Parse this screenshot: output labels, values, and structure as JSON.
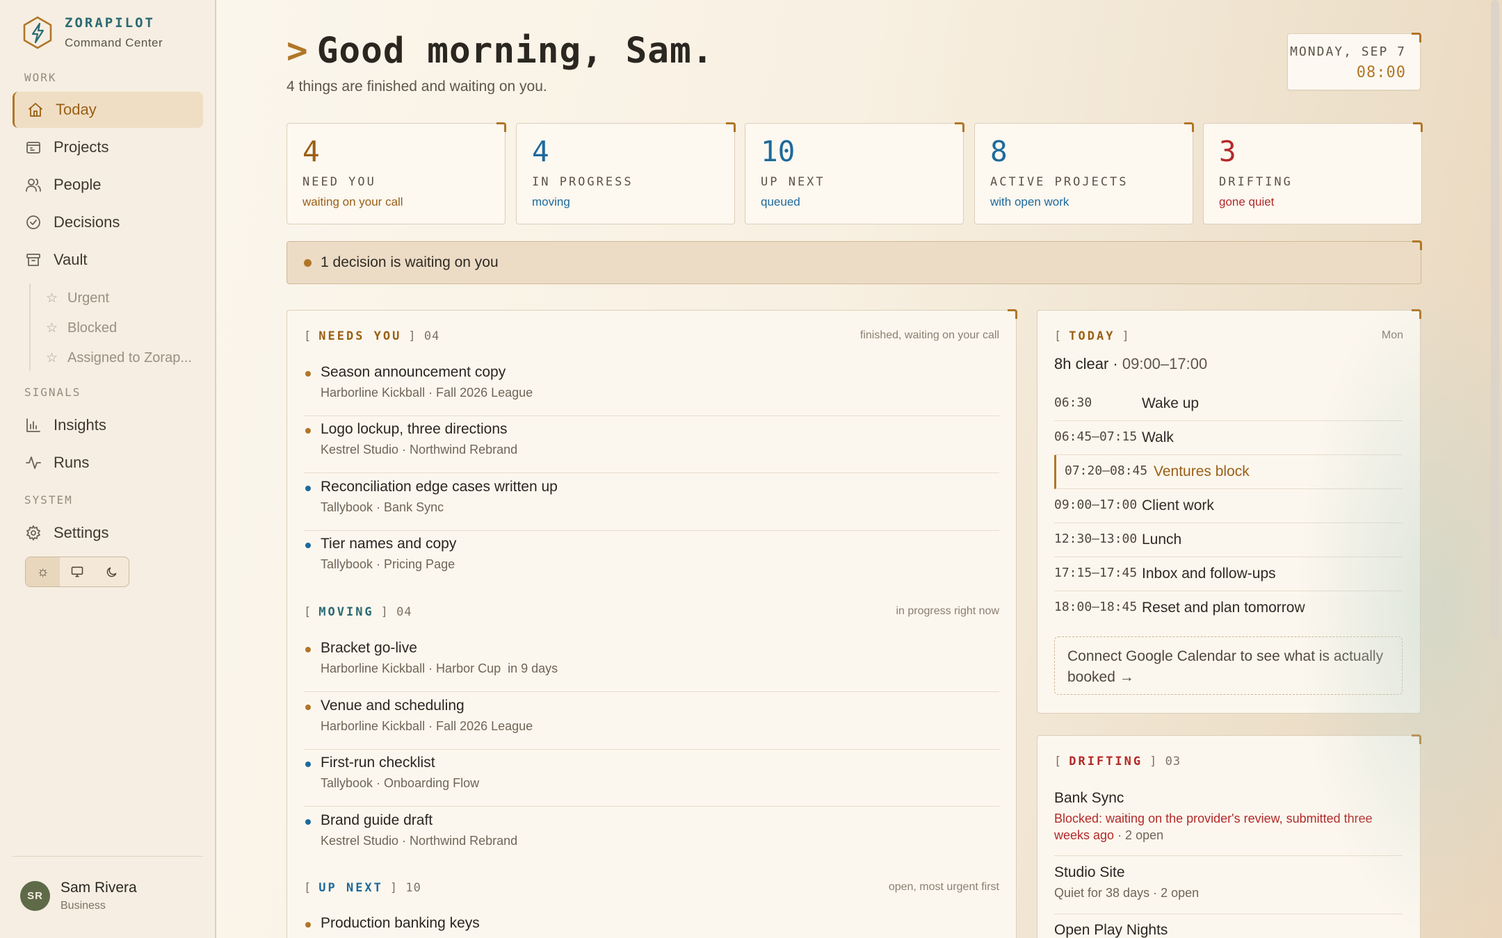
{
  "brand": {
    "name": "ZORAPILOT",
    "subtitle": "Command Center",
    "icon": "bolt-hexagon-icon"
  },
  "sidebar": {
    "sections": {
      "work": "WORK",
      "signals": "SIGNALS",
      "system": "SYSTEM"
    },
    "work_items": [
      {
        "label": "Today",
        "icon": "home-icon",
        "active": true
      },
      {
        "label": "Projects",
        "icon": "folder-icon"
      },
      {
        "label": "People",
        "icon": "people-icon"
      },
      {
        "label": "Decisions",
        "icon": "check-circle-icon"
      },
      {
        "label": "Vault",
        "icon": "archive-icon"
      }
    ],
    "vault_sub": [
      {
        "label": "Urgent",
        "icon": "star-icon"
      },
      {
        "label": "Blocked",
        "icon": "star-icon"
      },
      {
        "label": "Assigned to Zorap...",
        "icon": "star-icon"
      }
    ],
    "signal_items": [
      {
        "label": "Insights",
        "icon": "bar-chart-icon"
      },
      {
        "label": "Runs",
        "icon": "activity-icon"
      }
    ],
    "system_items": [
      {
        "label": "Settings",
        "icon": "gear-icon"
      }
    ],
    "theme_options": [
      "light",
      "system",
      "dark"
    ],
    "theme_selected": "light",
    "user": {
      "initials": "SR",
      "name": "Sam Rivera",
      "plan": "Business"
    }
  },
  "header": {
    "prompt": ">",
    "greeting": "Good morning, Sam.",
    "subtitle": "4 things are finished and waiting on you.",
    "date": "MONDAY, SEP 7",
    "time": "08:00"
  },
  "stats": [
    {
      "value": "4",
      "label": "NEED YOU",
      "hint": "waiting on your call",
      "color": "#9a5f16"
    },
    {
      "value": "4",
      "label": "IN PROGRESS",
      "hint": "moving",
      "color": "#1d6a9c"
    },
    {
      "value": "10",
      "label": "UP NEXT",
      "hint": "queued",
      "color": "#1d6a9c"
    },
    {
      "value": "8",
      "label": "ACTIVE PROJECTS",
      "hint": "with open work",
      "color": "#1d6a9c"
    },
    {
      "value": "3",
      "label": "DRIFTING",
      "hint": "gone quiet",
      "color": "#b22a2a"
    }
  ],
  "alert": {
    "text": "1 decision is waiting on you"
  },
  "needs_you": {
    "tag": "NEEDS YOU",
    "count": "04",
    "note": "finished, waiting on your call",
    "items": [
      {
        "title": "Season announcement copy",
        "meta": "Harborline Kickball · Fall 2026 League",
        "dot": "#b07628"
      },
      {
        "title": "Logo lockup, three directions",
        "meta": "Kestrel Studio · Northwind Rebrand",
        "dot": "#b07628"
      },
      {
        "title": "Reconciliation edge cases written up",
        "meta": "Tallybook · Bank Sync",
        "dot": "#1d6a9c"
      },
      {
        "title": "Tier names and copy",
        "meta": "Tallybook · Pricing Page",
        "dot": "#1d6a9c"
      }
    ]
  },
  "moving": {
    "tag": "MOVING",
    "count": "04",
    "note": "in progress right now",
    "items": [
      {
        "title": "Bracket go-live",
        "meta": "Harborline Kickball · Harbor Cup  in 9 days",
        "dot": "#b07628"
      },
      {
        "title": "Venue and scheduling",
        "meta": "Harborline Kickball · Fall 2026 League",
        "dot": "#b07628"
      },
      {
        "title": "First-run checklist",
        "meta": "Tallybook · Onboarding Flow",
        "dot": "#1d6a9c"
      },
      {
        "title": "Brand guide draft",
        "meta": "Kestrel Studio · Northwind Rebrand",
        "dot": "#1d6a9c"
      }
    ]
  },
  "up_next": {
    "tag": "UP NEXT",
    "count": "10",
    "note": "open, most urgent first",
    "items": [
      {
        "title": "Production banking keys",
        "dot": "#b07628"
      }
    ]
  },
  "today": {
    "tag": "TODAY",
    "day": "Mon",
    "clear": "8h clear",
    "range": "09:00–17:00",
    "schedule": [
      {
        "time": "06:30",
        "label": "Wake up"
      },
      {
        "time": "06:45–07:15",
        "label": "Walk"
      },
      {
        "time": "07:20–08:45",
        "label": "Ventures block",
        "highlight": true
      },
      {
        "time": "09:00–17:00",
        "label": "Client work"
      },
      {
        "time": "12:30–13:00",
        "label": "Lunch"
      },
      {
        "time": "17:15–17:45",
        "label": "Inbox and follow-ups"
      },
      {
        "time": "18:00–18:45",
        "label": "Reset and plan tomorrow"
      }
    ],
    "connect": "Connect Google Calendar to see what is actually booked →"
  },
  "drifting": {
    "tag": "DRIFTING",
    "count": "03",
    "items": [
      {
        "name": "Bank Sync",
        "reason": "Blocked: waiting on the provider's review, submitted three weeks ago",
        "extra": " · 2 open"
      },
      {
        "name": "Studio Site",
        "desc": "Quiet for 38 days · 2 open"
      },
      {
        "name": "Open Play Nights"
      }
    ]
  },
  "colors": {
    "accent": "#b07628",
    "blue": "#1d6a9c",
    "red": "#b22a2a",
    "teal": "#2a6a72"
  }
}
